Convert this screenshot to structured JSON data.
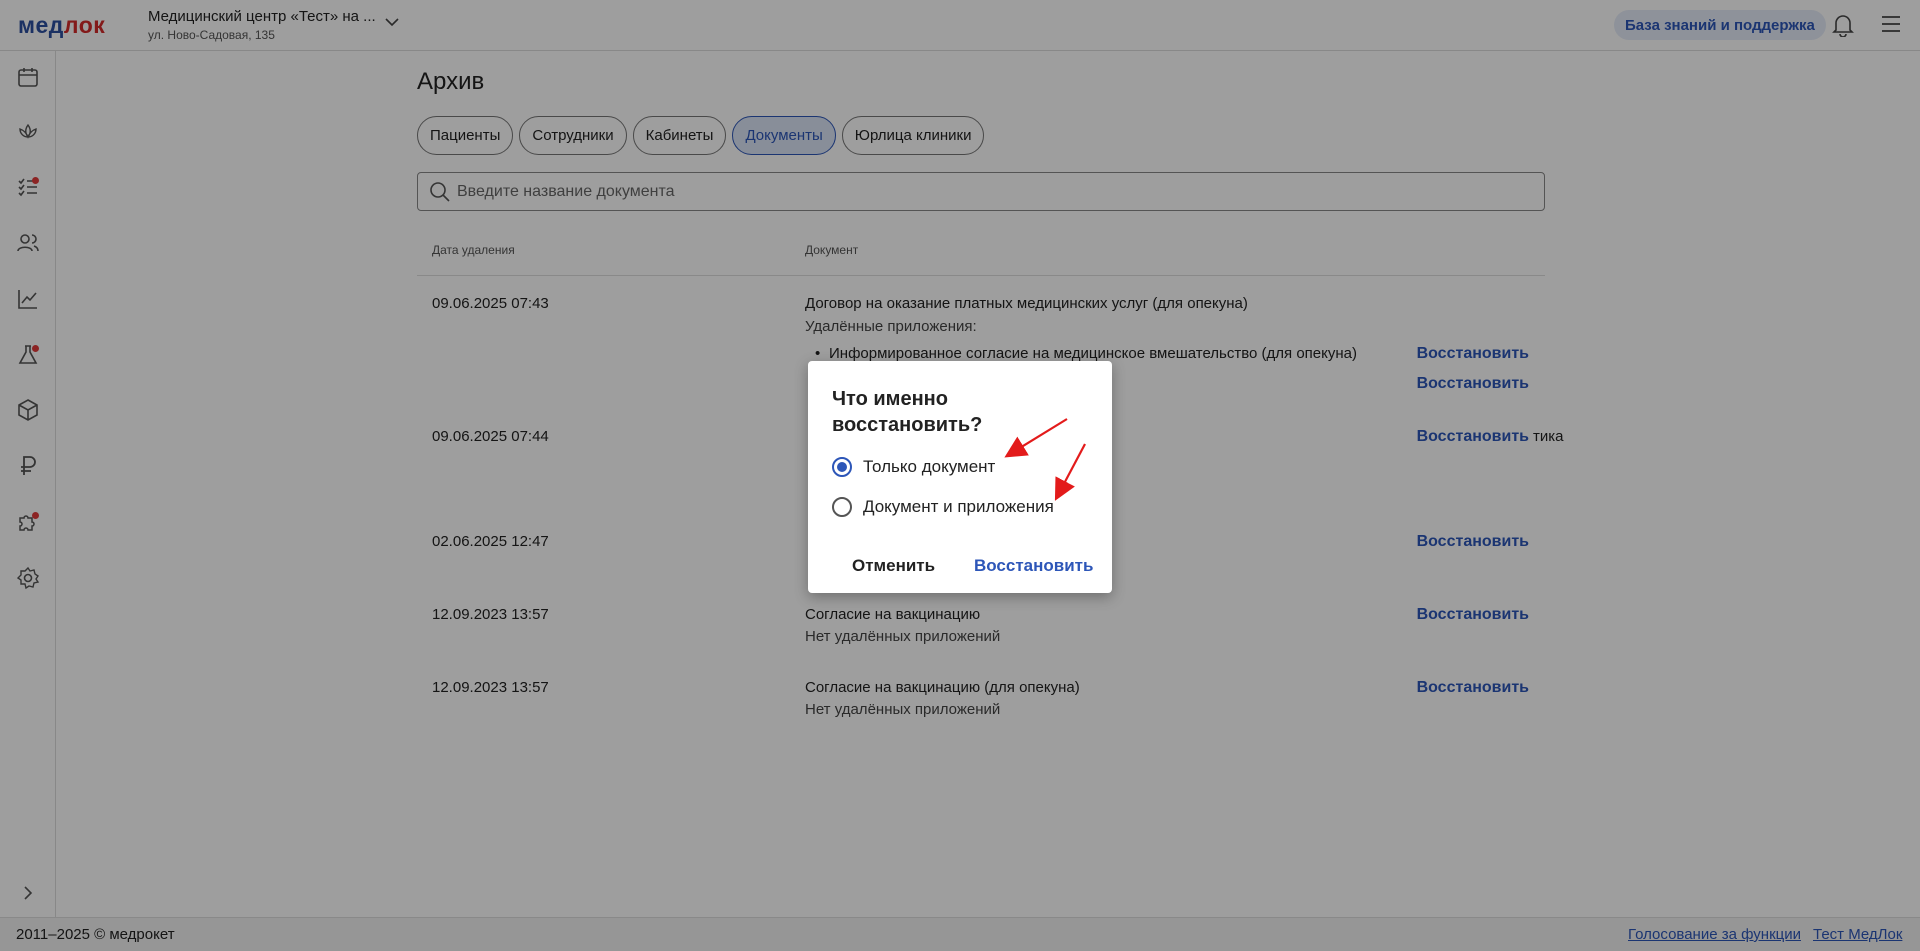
{
  "header": {
    "logo_main": "мед",
    "logo_accent": "лок",
    "clinic_name": "Медицинский центр «Тест» на ...",
    "clinic_address": "ул. Ново-Садовая, 135",
    "support_label": "База знаний и поддержка"
  },
  "sidebar": {
    "icons": [
      "calendar-icon",
      "lotus-icon",
      "tasks-icon",
      "users-icon",
      "analytics-icon",
      "lab-flask-icon",
      "box-icon",
      "ruble-icon",
      "puzzle-icon",
      "settings-icon"
    ]
  },
  "page": {
    "title": "Архив",
    "tabs": [
      "Пациенты",
      "Сотрудники",
      "Кабинеты",
      "Документы",
      "Юрлица клиники"
    ],
    "active_tab": "Документы",
    "search_placeholder": "Введите название документа"
  },
  "table": {
    "col_date": "Дата удаления",
    "col_doc": "Документ",
    "restore_label": "Восстановить",
    "rows": [
      {
        "date": "09.06.2025 07:43",
        "doc": "Договор на оказание платных медицинских услуг (для опекуна)",
        "sub": "Удалённые приложения:",
        "attachment": "Информированное согласие на медицинское вмешательство (для опекуна)"
      },
      {
        "date": "09.06.2025 07:44",
        "doc_partial": "тика"
      },
      {
        "date": "02.06.2025 12:47"
      },
      {
        "date": "12.09.2023 13:57",
        "doc": "Согласие на вакцинацию",
        "sub": "Нет удалённых приложений"
      },
      {
        "date": "12.09.2023 13:57",
        "doc": "Согласие на вакцинацию (для опекуна)",
        "sub": "Нет удалённых приложений"
      }
    ]
  },
  "dialog": {
    "title": "Что именно восстановить?",
    "option_1": "Только документ",
    "option_2": "Документ и приложения",
    "selected": "Только документ",
    "cancel_label": "Отменить",
    "confirm_label": "Восстановить"
  },
  "footer": {
    "copyright": "2011–2025 © медрокет",
    "vote_link": "Голосование за функции",
    "test_link": "Тест МедЛок"
  },
  "colors": {
    "accent": "#2d56b8",
    "logo_red": "#d42a2a",
    "badge": "#e23b3b",
    "annotation_arrow": "#e31b1b"
  }
}
